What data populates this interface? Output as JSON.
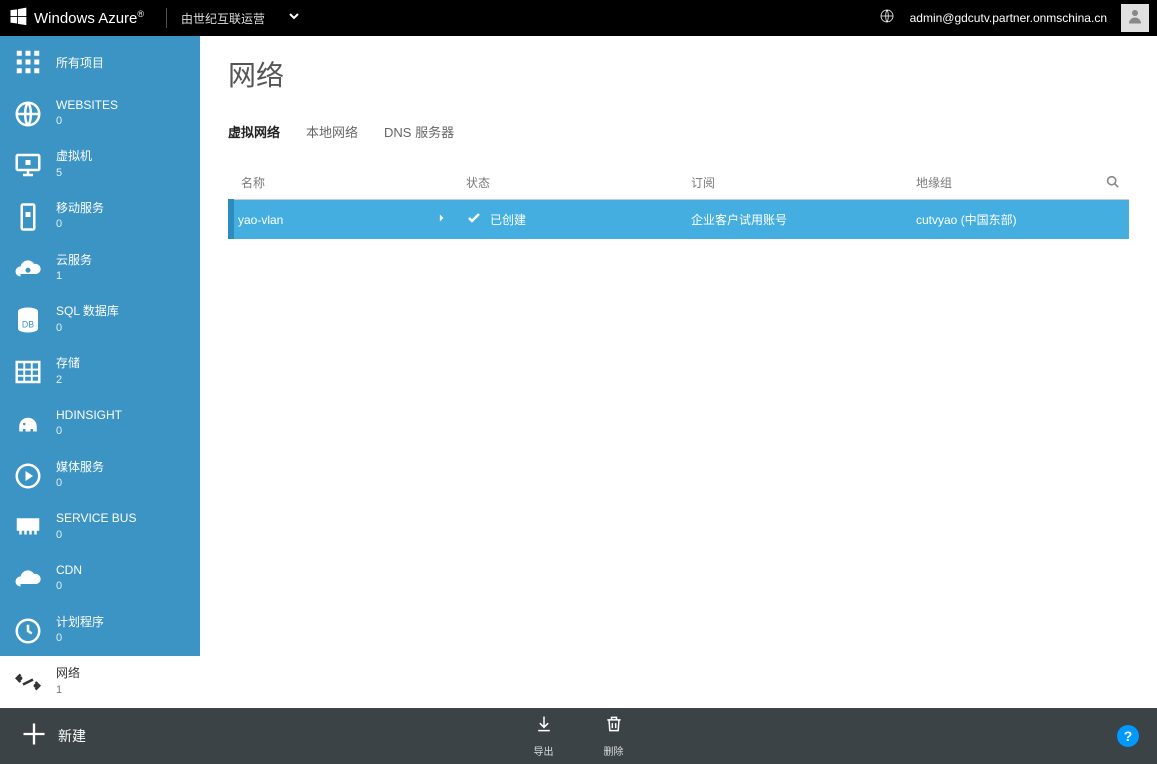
{
  "header": {
    "product": "Windows Azure",
    "operator": "由世纪互联运营",
    "email": "admin@gdcutv.partner.onmschina.cn"
  },
  "sidebar": {
    "items": [
      {
        "label": "所有项目",
        "count": null
      },
      {
        "label": "WEBSITES",
        "count": "0"
      },
      {
        "label": "虚拟机",
        "count": "5"
      },
      {
        "label": "移动服务",
        "count": "0"
      },
      {
        "label": "云服务",
        "count": "1"
      },
      {
        "label": "SQL 数据库",
        "count": "0"
      },
      {
        "label": "存储",
        "count": "2"
      },
      {
        "label": "HDINSIGHT",
        "count": "0"
      },
      {
        "label": "媒体服务",
        "count": "0"
      },
      {
        "label": "SERVICE BUS",
        "count": "0"
      },
      {
        "label": "CDN",
        "count": "0"
      },
      {
        "label": "计划程序",
        "count": "0"
      },
      {
        "label": "网络",
        "count": "1"
      }
    ]
  },
  "main": {
    "title": "网络",
    "tabs": [
      {
        "label": "虚拟网络"
      },
      {
        "label": "本地网络"
      },
      {
        "label": "DNS 服务器"
      }
    ],
    "columns": {
      "name": "名称",
      "status": "状态",
      "subscription": "订阅",
      "group": "地缘组"
    },
    "rows": [
      {
        "name": "yao-vlan",
        "status": "已创建",
        "subscription": "企业客户试用账号",
        "group": "cutvyao (中国东部)"
      }
    ]
  },
  "footer": {
    "new": "新建",
    "export": "导出",
    "delete": "删除",
    "help": "?"
  }
}
